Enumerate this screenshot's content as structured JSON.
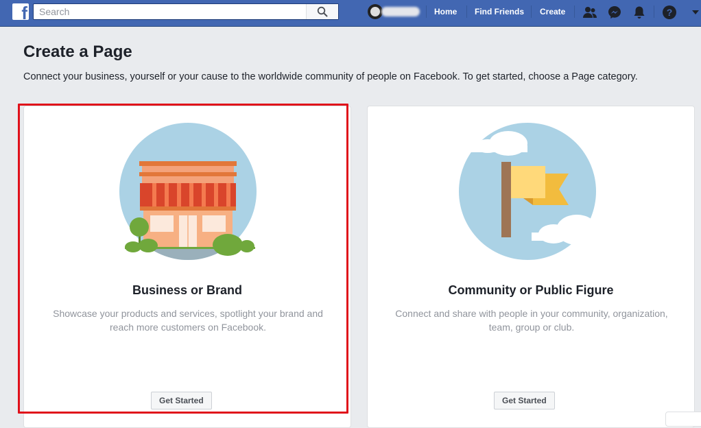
{
  "topbar": {
    "logo": "f",
    "search_placeholder": "Search",
    "nav": {
      "home": "Home",
      "find_friends": "Find Friends",
      "create": "Create"
    },
    "icons": [
      "friends-icon",
      "messenger-icon",
      "notifications-icon",
      "help-icon",
      "dropdown-arrow-icon"
    ],
    "brand_color": "#4267b2"
  },
  "page": {
    "title": "Create a Page",
    "subtitle": "Connect your business, yourself or your cause to the worldwide community of people on Facebook. To get started, choose a Page category."
  },
  "cards": [
    {
      "title": "Business or Brand",
      "description": "Showcase your products and services, spotlight your brand and reach more customers on Facebook.",
      "button": "Get Started",
      "highlighted": true
    },
    {
      "title": "Community or Public Figure",
      "description": "Connect and share with people in your community, organization, team, group or club.",
      "button": "Get Started",
      "highlighted": false
    }
  ],
  "colors": {
    "highlight": "#e0101a",
    "background": "#e9ebee"
  }
}
